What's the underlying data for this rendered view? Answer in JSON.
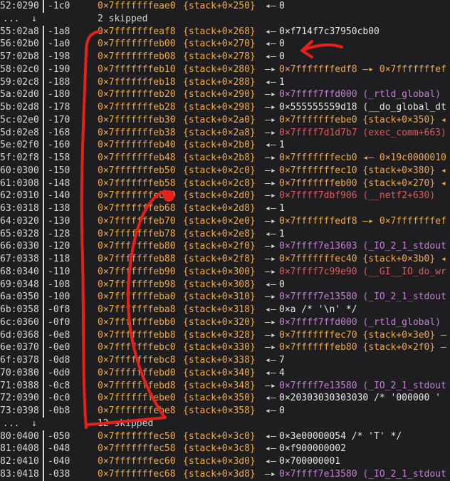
{
  "rows": [
    {
      "kind": "entry",
      "idx": "52:0290",
      "off": "-1c0",
      "addr": "0×7fffffffeae0",
      "sym": "{stack+0×250}",
      "arrow": "◂—",
      "value": "0",
      "vcolor": "plain"
    },
    {
      "kind": "skip",
      "dots": "...",
      "arrow": "↓",
      "text": "2 skipped"
    },
    {
      "kind": "entry",
      "idx": "55:02a8",
      "off": "-1a8",
      "addr": "0×7fffffffeaf8",
      "sym": "{stack+0×268}",
      "arrow": "◂—",
      "value": "0×f714f7c37950cb00",
      "vcolor": "plain"
    },
    {
      "kind": "entry",
      "idx": "56:02b0",
      "off": "-1a0",
      "addr": "0×7fffffffeb00",
      "sym": "{stack+0×270}",
      "arrow": "◂—",
      "value": "0",
      "vcolor": "plain"
    },
    {
      "kind": "entry",
      "idx": "57:02b8",
      "off": "-198",
      "addr": "0×7fffffffeb08",
      "sym": "{stack+0×278}",
      "arrow": "◂—",
      "value": "0",
      "vcolor": "plain"
    },
    {
      "kind": "entry",
      "idx": "58:02c0",
      "off": "-190",
      "addr": "0×7fffffffeb10",
      "sym": "{stack+0×280}",
      "arrow": "—▸",
      "value": "0×7fffffffedf8 —▸ 0×7fffffffef",
      "vcolor": "addr"
    },
    {
      "kind": "entry",
      "idx": "59:02c8",
      "off": "-188",
      "addr": "0×7fffffffeb18",
      "sym": "{stack+0×288}",
      "arrow": "◂—",
      "value": "1",
      "vcolor": "plain"
    },
    {
      "kind": "entry",
      "idx": "5a:02d0",
      "off": "-180",
      "addr": "0×7fffffffeb20",
      "sym": "{stack+0×290}",
      "arrow": "—▸",
      "value": "0×7ffff7ffd000 (_rtld_global)",
      "vcolor": "lib"
    },
    {
      "kind": "entry",
      "idx": "5b:02d8",
      "off": "-178",
      "addr": "0×7fffffffeb28",
      "sym": "{stack+0×298}",
      "arrow": "—▸",
      "value": "0×555555559d18 (__do_global_dt",
      "vcolor": "plain"
    },
    {
      "kind": "entry",
      "idx": "5c:02e0",
      "off": "-170",
      "addr": "0×7fffffffeb30",
      "sym": "{stack+0×2a0}",
      "arrow": "—▸",
      "value": "0×7fffffffebe0 {stack+0×350} ◂",
      "vcolor": "addr"
    },
    {
      "kind": "entry",
      "idx": "5d:02e8",
      "off": "-168",
      "addr": "0×7fffffffeb38",
      "sym": "{stack+0×2a8}",
      "arrow": "—▸",
      "value": "0×7ffff7d1d7b7 (exec_comm+663)",
      "vcolor": "exec"
    },
    {
      "kind": "entry",
      "idx": "5e:02f0",
      "off": "-160",
      "addr": "0×7fffffffeb40",
      "sym": "{stack+0×2b0}",
      "arrow": "◂—",
      "value": "1",
      "vcolor": "plain"
    },
    {
      "kind": "entry",
      "idx": "5f:02f8",
      "off": "-158",
      "addr": "0×7fffffffeb48",
      "sym": "{stack+0×2b8}",
      "arrow": "—▸",
      "value": "0×7fffffffecb0 ◂— 0×19c0000010",
      "vcolor": "addr"
    },
    {
      "kind": "entry",
      "idx": "60:0300",
      "off": "-150",
      "addr": "0×7fffffffeb50",
      "sym": "{stack+0×2c0}",
      "arrow": "—▸",
      "value": "0×7fffffffec10 {stack+0×380} ◂",
      "vcolor": "addr"
    },
    {
      "kind": "entry",
      "idx": "61:0308",
      "off": "-148",
      "addr": "0×7fffffffeb58",
      "sym": "{stack+0×2c8}",
      "arrow": "—▸",
      "value": "0×7fffffffeb00 {stack+0×270} ◂",
      "vcolor": "addr"
    },
    {
      "kind": "entry",
      "idx": "62:0310",
      "off": "-140",
      "addr": "0×7fffffffeb60",
      "sym": "{stack+0×2d0}",
      "arrow": "—▸",
      "value": "0×7ffff7dbf906 (__netf2+630)",
      "vcolor": "exec"
    },
    {
      "kind": "entry",
      "idx": "63:0318",
      "off": "-138",
      "addr": "0×7fffffffeb68",
      "sym": "{stack+0×2d8}",
      "arrow": "◂—",
      "value": "1",
      "vcolor": "plain"
    },
    {
      "kind": "entry",
      "idx": "64:0320",
      "off": "-130",
      "addr": "0×7fffffffeb70",
      "sym": "{stack+0×2e0}",
      "arrow": "—▸",
      "value": "0×7fffffffedf8 —▸ 0×7fffffffef",
      "vcolor": "addr"
    },
    {
      "kind": "entry",
      "idx": "65:0328",
      "off": "-128",
      "addr": "0×7fffffffeb78",
      "sym": "{stack+0×2e8}",
      "arrow": "◂—",
      "value": "1",
      "vcolor": "plain"
    },
    {
      "kind": "entry",
      "idx": "66:0330",
      "off": "-120",
      "addr": "0×7fffffffeb80",
      "sym": "{stack+0×2f0}",
      "arrow": "—▸",
      "value": "0×7ffff7e13603 (_IO_2_1_stdout",
      "vcolor": "lib"
    },
    {
      "kind": "entry",
      "idx": "67:0338",
      "off": "-118",
      "addr": "0×7fffffffeb88",
      "sym": "{stack+0×2f8}",
      "arrow": "—▸",
      "value": "0×7fffffffec40 {stack+0×3b0} ◂",
      "vcolor": "addr"
    },
    {
      "kind": "entry",
      "idx": "68:0340",
      "off": "-110",
      "addr": "0×7fffffffeb90",
      "sym": "{stack+0×300}",
      "arrow": "—▸",
      "value": "0×7ffff7c99e90 (__GI__IO_do_wr",
      "vcolor": "exec"
    },
    {
      "kind": "entry",
      "idx": "69:0348",
      "off": "-108",
      "addr": "0×7fffffffeb98",
      "sym": "{stack+0×308}",
      "arrow": "◂—",
      "value": "0",
      "vcolor": "plain"
    },
    {
      "kind": "entry",
      "idx": "6a:0350",
      "off": "-100",
      "addr": "0×7fffffffeba0",
      "sym": "{stack+0×310}",
      "arrow": "—▸",
      "value": "0×7ffff7e13580 (_IO_2_1_stdout",
      "vcolor": "lib"
    },
    {
      "kind": "entry",
      "idx": "6b:0358",
      "off": "-0f8",
      "addr": "0×7fffffffeba8",
      "sym": "{stack+0×318}",
      "arrow": "◂—",
      "value": "0×a /* '\\n' */",
      "vcolor": "plain"
    },
    {
      "kind": "entry",
      "idx": "6c:0360",
      "off": "-0f0",
      "addr": "0×7fffffffebb0",
      "sym": "{stack+0×320}",
      "arrow": "—▸",
      "value": "0×7ffff7ffd000 (_rtld_global)",
      "vcolor": "lib"
    },
    {
      "kind": "entry",
      "idx": "6d:0368",
      "off": "-0e8",
      "addr": "0×7fffffffebb8",
      "sym": "{stack+0×328}",
      "arrow": "—▸",
      "value": "0×7fffffffec70 {stack+0×3e0} —",
      "vcolor": "addr"
    },
    {
      "kind": "entry",
      "idx": "6e:0370",
      "off": "-0e0",
      "addr": "0×7fffffffebc0",
      "sym": "{stack+0×330}",
      "arrow": "—▸",
      "value": "0×7fffffffeb80 {stack+0×2f0} —",
      "vcolor": "addr"
    },
    {
      "kind": "entry",
      "idx": "6f:0378",
      "off": "-0d8",
      "addr": "0×7fffffffebc8",
      "sym": "{stack+0×338}",
      "arrow": "◂—",
      "value": "7",
      "vcolor": "plain"
    },
    {
      "kind": "entry",
      "idx": "70:0380",
      "off": "-0d0",
      "addr": "0×7fffffffebd0",
      "sym": "{stack+0×340}",
      "arrow": "◂—",
      "value": "4",
      "vcolor": "plain"
    },
    {
      "kind": "entry",
      "idx": "71:0388",
      "off": "-0c8",
      "addr": "0×7fffffffebd8",
      "sym": "{stack+0×348}",
      "arrow": "—▸",
      "value": "0×7ffff7e13580 (_IO_2_1_stdout",
      "vcolor": "lib"
    },
    {
      "kind": "entry",
      "idx": "72:0390",
      "off": "-0c0",
      "addr": "0×7fffffffebe0",
      "sym": "{stack+0×350}",
      "arrow": "◂—",
      "value": "0×20303030303030 /* '000000 '",
      "vcolor": "plain"
    },
    {
      "kind": "entry",
      "idx": "73:0398",
      "off": "-0b8",
      "addr": "0×7fffffffebe8",
      "sym": "{stack+0×358}",
      "arrow": "◂—",
      "value": "0",
      "vcolor": "plain"
    },
    {
      "kind": "skip",
      "dots": "...",
      "arrow": "↓",
      "text": "12 skipped"
    },
    {
      "kind": "entry",
      "idx": "80:0400",
      "off": "-050",
      "addr": "0×7fffffffec50",
      "sym": "{stack+0×3c0}",
      "arrow": "◂—",
      "value": "0×3e00000054 /* 'T' */",
      "vcolor": "plain"
    },
    {
      "kind": "entry",
      "idx": "81:0408",
      "off": "-048",
      "addr": "0×7fffffffec58",
      "sym": "{stack+0×3c8}",
      "arrow": "◂—",
      "value": "0×f900000002",
      "vcolor": "plain"
    },
    {
      "kind": "entry",
      "idx": "82:0410",
      "off": "-040",
      "addr": "0×7fffffffec60",
      "sym": "{stack+0×3d0}",
      "arrow": "◂—",
      "value": "0×700000001",
      "vcolor": "plain"
    },
    {
      "kind": "entry",
      "idx": "83:0418",
      "off": "-038",
      "addr": "0×7fffffffec68",
      "sym": "{stack+0×3d8}",
      "arrow": "—▸",
      "value": "0×7ffff7e13580 (_IO_2_1_stdout",
      "vcolor": "lib"
    }
  ],
  "colors": {
    "background": "#1e1e21",
    "text": "#d7d7d7",
    "address": "#f0a94a",
    "library": "#c77dd6",
    "executable": "#e05a5a",
    "annotation": "#e8201c"
  }
}
